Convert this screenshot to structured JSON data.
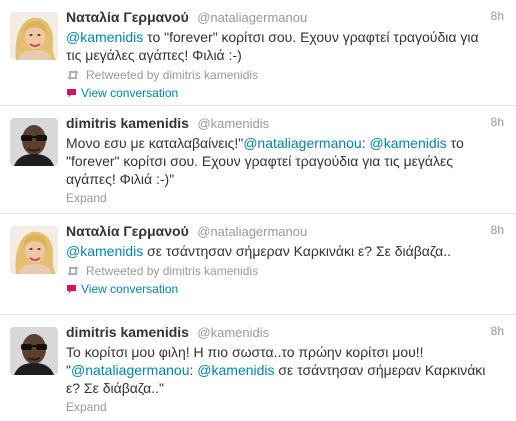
{
  "tweets": [
    {
      "avatar": "nataliagermanou-avatar",
      "fullname": "Ναταλία Γερμανού",
      "username": "@nataliagermanou",
      "time": "8h",
      "text": [
        {
          "mention": "@kamenidis"
        },
        {
          "text": " το \"forever\" κορίτσι σου. Εχουν γραφτεί τραγούδια για τις μεγάλες αγάπες! Φιλιά :-)"
        }
      ],
      "retweeted_by": "Retweeted by dimitris kamenidis",
      "action": "View conversation",
      "action_type": "conversation"
    },
    {
      "avatar": "kamenidis-avatar",
      "fullname": "dimitris kamenidis",
      "username": "@kamenidis",
      "time": "8h",
      "text": [
        {
          "text": "Μονο εσυ με καταλαβαίνεις!\""
        },
        {
          "mention": "@nataliagermanou"
        },
        {
          "text": ": "
        },
        {
          "mention": "@kamenidis"
        },
        {
          "text": " το \"forever\" κορίτσι σου. Εχουν γραφτεί τραγούδια για τις μεγάλες αγάπες! Φιλιά :-)\""
        }
      ],
      "retweeted_by": "",
      "action": "Expand",
      "action_type": "expand"
    },
    {
      "avatar": "nataliagermanou-avatar",
      "fullname": "Ναταλία Γερμανού",
      "username": "@nataliagermanou",
      "time": "8h",
      "text": [
        {
          "mention": "@kamenidis"
        },
        {
          "text": " σε τσάντησαν σήμεραν Καρκινάκι ε? Σε διάβαζα.."
        }
      ],
      "retweeted_by": "Retweeted by dimitris kamenidis",
      "action": "View conversation",
      "action_type": "conversation"
    },
    {
      "avatar": "kamenidis-avatar",
      "fullname": "dimitris kamenidis",
      "username": "@kamenidis",
      "time": "8h",
      "text": [
        {
          "text": "Το κορίτσι μου φιλη! Η πιο σωστα..το πρώην κορίτσι μου!! \""
        },
        {
          "mention": "@nataliagermanou"
        },
        {
          "text": ": "
        },
        {
          "mention": "@kamenidis"
        },
        {
          "text": " σε τσάντησαν σήμεραν Καρκινάκι ε? Σε διάβαζα..\""
        }
      ],
      "retweeted_by": "",
      "action": "Expand",
      "action_type": "expand"
    }
  ],
  "colors": {
    "link": "#0084b4",
    "muted": "#999999",
    "text": "#333333",
    "conversation_icon": "#d4145a",
    "divider": "#e8e8e8"
  },
  "icons": {
    "retweet": "retweet-icon",
    "conversation": "speech-bubble-icon"
  }
}
